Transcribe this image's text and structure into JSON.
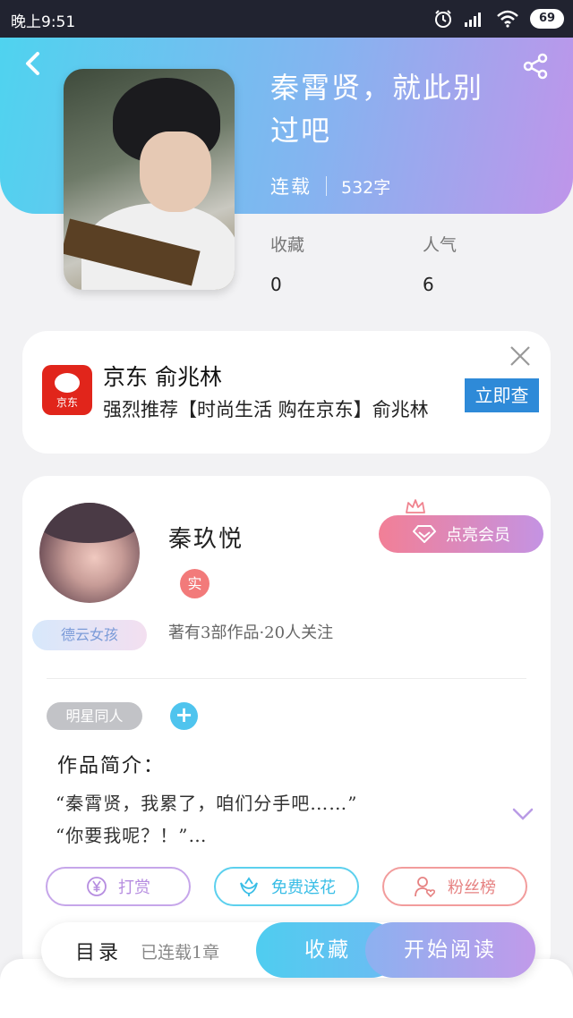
{
  "status_bar": {
    "time": "晚上9:51",
    "battery": "69",
    "icons": [
      "alarm-icon",
      "signal-icon",
      "wifi-icon",
      "battery-icon"
    ]
  },
  "header": {
    "back_icon": "back-arrow-icon",
    "share_icon": "share-icon"
  },
  "book": {
    "title": "秦霄贤，就此别过吧",
    "status": "连载",
    "word_count": "532字",
    "favorites_label": "收藏",
    "favorites_value": "0",
    "popularity_label": "人气",
    "popularity_value": "6"
  },
  "ad": {
    "logo_text": "京东",
    "title": "京东 俞兆林",
    "description": "强烈推荐【时尚生活 购在京东】俞兆林",
    "cta": "立即查",
    "close_icon": "close-icon"
  },
  "author": {
    "name": "秦玖悦",
    "badge_label": "德云女孩",
    "verify_badge": "实",
    "stats": "著有3部作品·20人关注",
    "member_button": "点亮会员",
    "tag": "明星同人",
    "tag_add": "+",
    "intro_title": "作品简介：",
    "intro_line1": "“秦霄贤，我累了，咱们分手吧……”",
    "intro_line2": "“你要我呢？！”…"
  },
  "actions": {
    "reward": "打赏",
    "flower": "免费送花",
    "fans": "粉丝榜"
  },
  "bottom_bar": {
    "toc": "目录",
    "chapter_info": "已连载1章",
    "favorite": "收藏",
    "start_reading": "开始阅读"
  },
  "colors": {
    "header_gradient_start": "#4fd3ef",
    "header_gradient_end": "#bf95ea",
    "accent_blue": "#4fcdf0",
    "accent_purple": "#c19aea",
    "ad_red": "#e1251b",
    "cta_blue": "#2e8ad8"
  }
}
